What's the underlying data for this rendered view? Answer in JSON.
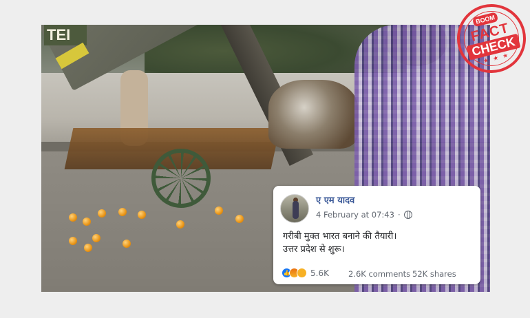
{
  "video": {
    "crane_sign_text": "TEI"
  },
  "post": {
    "author": "ए एम यादव",
    "date": "4 February at 07:43",
    "privacy_icon": "globe-icon",
    "body_line1": "गरीबी मुक्त भारत बनाने की तैयारी।",
    "body_line2": "उत्तर प्रदेश से शुरू।",
    "reaction_icons": [
      "like-icon",
      "angry-icon",
      "sad-icon"
    ],
    "reaction_count": "5.6K",
    "comments": "2.6K comments",
    "shares": "52K shares"
  },
  "stamp": {
    "brand": "BOOM",
    "line1": "FACT",
    "line2": "CHECK",
    "stars": "★ ★ ★"
  },
  "colors": {
    "background": "#eeeeee",
    "fb_link": "#3b5998",
    "stamp_red": "#e2353c"
  }
}
